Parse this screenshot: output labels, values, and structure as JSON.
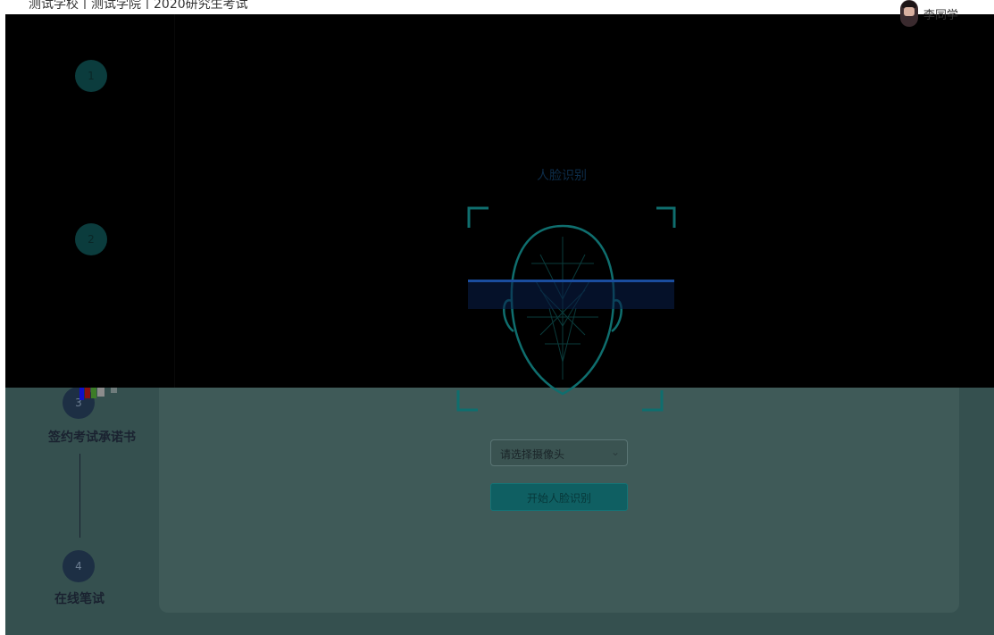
{
  "header": {
    "title": "测试学校丨测试学院丨2020研究生考试",
    "user": "李同学"
  },
  "steps": [
    {
      "number": "1",
      "label": "",
      "state": "done"
    },
    {
      "number": "2",
      "label": "",
      "state": "done"
    },
    {
      "number": "3",
      "label": "签约考试承诺书",
      "state": "todo"
    },
    {
      "number": "4",
      "label": "在线笔试",
      "state": "todo"
    }
  ],
  "face_verify": {
    "title": "人脸识别",
    "camera_placeholder": "请选择摄像头",
    "start_button": "开始人脸识别"
  },
  "colors": {
    "accent": "#0f6e6e",
    "scan_line": "#1a4d9e",
    "overlay": "#000000"
  }
}
